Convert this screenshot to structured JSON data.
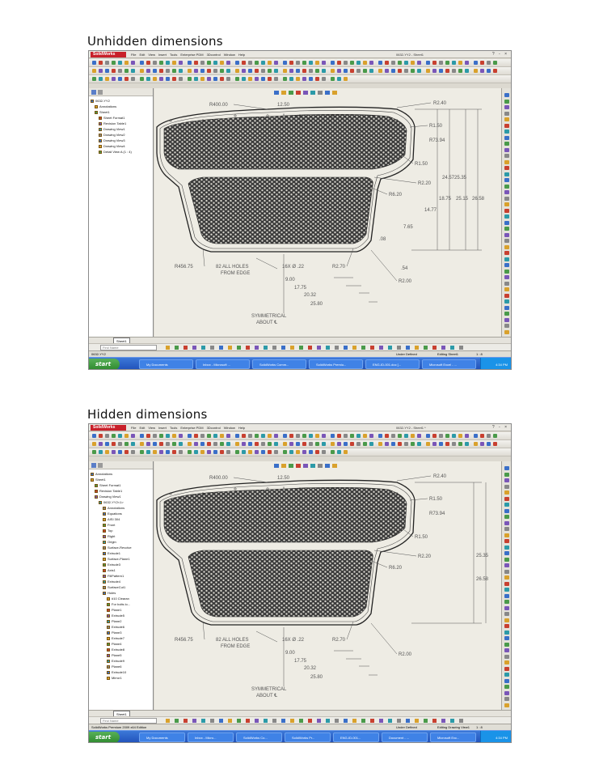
{
  "captions": {
    "top": "Unhidden dimensions",
    "bottom": "Hidden dimensions"
  },
  "app": {
    "logo": "SolidWorks",
    "menu": [
      "File",
      "Edit",
      "View",
      "Insert",
      "Tools",
      "Enterprise PDM",
      "3Dcontrol",
      "Window",
      "Help"
    ],
    "window_controls": "? - ×",
    "search_placeholder": "Find Name"
  },
  "screens": [
    {
      "title": "0632-YY2 - Sheet1",
      "tree": [
        {
          "label": "0632-YY2",
          "level": 0,
          "icon": "drawing-icon"
        },
        {
          "label": "Annotations",
          "level": 1,
          "icon": "annotations-icon"
        },
        {
          "label": "Sheet1",
          "level": 1,
          "icon": "sheet-icon"
        },
        {
          "label": "Sheet Format1",
          "level": 2,
          "icon": "sheet-format-icon"
        },
        {
          "label": "Revision Table1",
          "level": 2,
          "icon": "table-icon"
        },
        {
          "label": "Drawing View1",
          "level": 2,
          "icon": "view-icon"
        },
        {
          "label": "Drawing View2",
          "level": 2,
          "icon": "view-icon"
        },
        {
          "label": "Drawing View3",
          "level": 2,
          "icon": "view-icon"
        },
        {
          "label": "Drawing View4",
          "level": 2,
          "icon": "view-icon"
        },
        {
          "label": "Detail View A (1 : 4)",
          "level": 2,
          "icon": "view-icon"
        }
      ],
      "sheet_tab": "Sheet1",
      "status_left": "0632-YY2",
      "status_mid": "Under Defined",
      "status_editing": "Editing Sheet1",
      "status_scale": "1 : 8",
      "taskbar": [
        "My Documents",
        "Inbox - Microsoft ...",
        "SolidWorks Comm...",
        "SolidWorks Premiu...",
        "ENG-ID-001.doc [...",
        "Microsoft Excel - ..."
      ],
      "clock": "4:34 PM"
    },
    {
      "title": "0632-YY2 - Sheet1 *",
      "tree": [
        {
          "label": "Annotations",
          "level": 0,
          "icon": "annotations-icon"
        },
        {
          "label": "Sheet1",
          "level": 0,
          "icon": "sheet-icon"
        },
        {
          "label": "Sheet Format1",
          "level": 1,
          "icon": "sheet-format-icon"
        },
        {
          "label": "Revision Table1",
          "level": 1,
          "icon": "table-icon"
        },
        {
          "label": "Drawing View1",
          "level": 1,
          "icon": "view-icon"
        },
        {
          "label": "0632-YY2<1>",
          "level": 2,
          "icon": "part-icon"
        },
        {
          "label": "Annotations",
          "level": 3,
          "icon": "annotations-icon"
        },
        {
          "label": "Equations",
          "level": 3,
          "icon": "equations-icon"
        },
        {
          "label": "AISI 304",
          "level": 3,
          "icon": "material-icon"
        },
        {
          "label": "Front",
          "level": 3,
          "icon": "plane-icon"
        },
        {
          "label": "Top",
          "level": 3,
          "icon": "plane-icon"
        },
        {
          "label": "Right",
          "level": 3,
          "icon": "plane-icon"
        },
        {
          "label": "Origin",
          "level": 3,
          "icon": "origin-icon"
        },
        {
          "label": "Surface-Revolve",
          "level": 3,
          "icon": "feature-icon"
        },
        {
          "label": "Extrude1",
          "level": 3,
          "icon": "feature-icon"
        },
        {
          "label": "Surface-Plane1",
          "level": 3,
          "icon": "feature-icon"
        },
        {
          "label": "Extrude3",
          "level": 3,
          "icon": "feature-icon"
        },
        {
          "label": "Axis1",
          "level": 3,
          "icon": "axis-icon"
        },
        {
          "label": "FillPattern1",
          "level": 3,
          "icon": "feature-icon"
        },
        {
          "label": "Extrude4",
          "level": 3,
          "icon": "feature-icon"
        },
        {
          "label": "SurfaceCut1",
          "level": 3,
          "icon": "feature-icon"
        },
        {
          "label": "Holes",
          "level": 3,
          "icon": "folder-icon"
        },
        {
          "label": "#10 Clearan",
          "level": 4,
          "icon": "feature-icon"
        },
        {
          "label": "For bolts lo...",
          "level": 4,
          "icon": "sketch-icon"
        },
        {
          "label": "Plane1",
          "level": 4,
          "icon": "plane-icon"
        },
        {
          "label": "Extrude5",
          "level": 4,
          "icon": "feature-icon"
        },
        {
          "label": "Plane2",
          "level": 4,
          "icon": "plane-icon"
        },
        {
          "label": "Extrude6",
          "level": 4,
          "icon": "feature-icon"
        },
        {
          "label": "Plane3",
          "level": 4,
          "icon": "plane-icon"
        },
        {
          "label": "Extrude7",
          "level": 4,
          "icon": "feature-icon"
        },
        {
          "label": "Plane4",
          "level": 4,
          "icon": "plane-icon"
        },
        {
          "label": "Extrude8",
          "level": 4,
          "icon": "feature-icon"
        },
        {
          "label": "Plane5",
          "level": 4,
          "icon": "plane-icon"
        },
        {
          "label": "Extrude9",
          "level": 4,
          "icon": "feature-icon"
        },
        {
          "label": "Plane6",
          "level": 4,
          "icon": "plane-icon"
        },
        {
          "label": "Extrude10",
          "level": 4,
          "icon": "feature-icon"
        },
        {
          "label": "Mirror1",
          "level": 4,
          "icon": "feature-icon"
        }
      ],
      "sheet_tab": "Sheet1",
      "status_left": "SolidWorks Premium 2009 x64 Edition",
      "status_mid": "Under Defined",
      "status_editing": "Editing Drawing View1",
      "status_scale": "1 : 8",
      "taskbar": [
        "My Documents",
        "Inbox - Micro...",
        "SolidWorks Co...",
        "SolidWorks Pr...",
        "ENG-ID-001...",
        "Document - ...",
        "Microsoft Exc..."
      ],
      "clock": "4:34 PM"
    }
  ],
  "drawing": {
    "start": "start",
    "unhidden": {
      "labels": [
        "R400.00",
        "12.50",
        "A",
        "R2.40",
        "R1.50",
        "R73.94",
        "R1.50",
        "R2.20",
        "R6.20",
        "24.57",
        "25.35",
        "18.75",
        "25.15",
        "26.58",
        "14.77",
        "7.65",
        ".08",
        "R456.75",
        "82 ALL HOLES",
        "FROM EDGE",
        "16X Ø .22",
        "R2.70",
        ".54",
        "9.00",
        "17.75",
        "20.32",
        "25.80",
        "R2.00",
        "SYMMETRICAL",
        "ABOUT ℄"
      ]
    },
    "hidden": {
      "labels": [
        "R400.00",
        "12.50",
        "A",
        "R2.40",
        "R1.50",
        "R73.94",
        "R1.50",
        "R2.20",
        "R6.20",
        "25.35",
        "26.58",
        "R456.75",
        "82 ALL HOLES",
        "FROM EDGE",
        "16X Ø .22",
        "R2.70",
        "9.00",
        "17.75",
        "20.32",
        "25.80",
        "R2.00",
        "SYMMETRICAL",
        "ABOUT ℄"
      ]
    }
  },
  "colors": {
    "sw_red": "#c8202a",
    "taskbar_blue": "#2a62d0",
    "canvas": "#eeece4",
    "start_green": "#3b9a3b"
  }
}
